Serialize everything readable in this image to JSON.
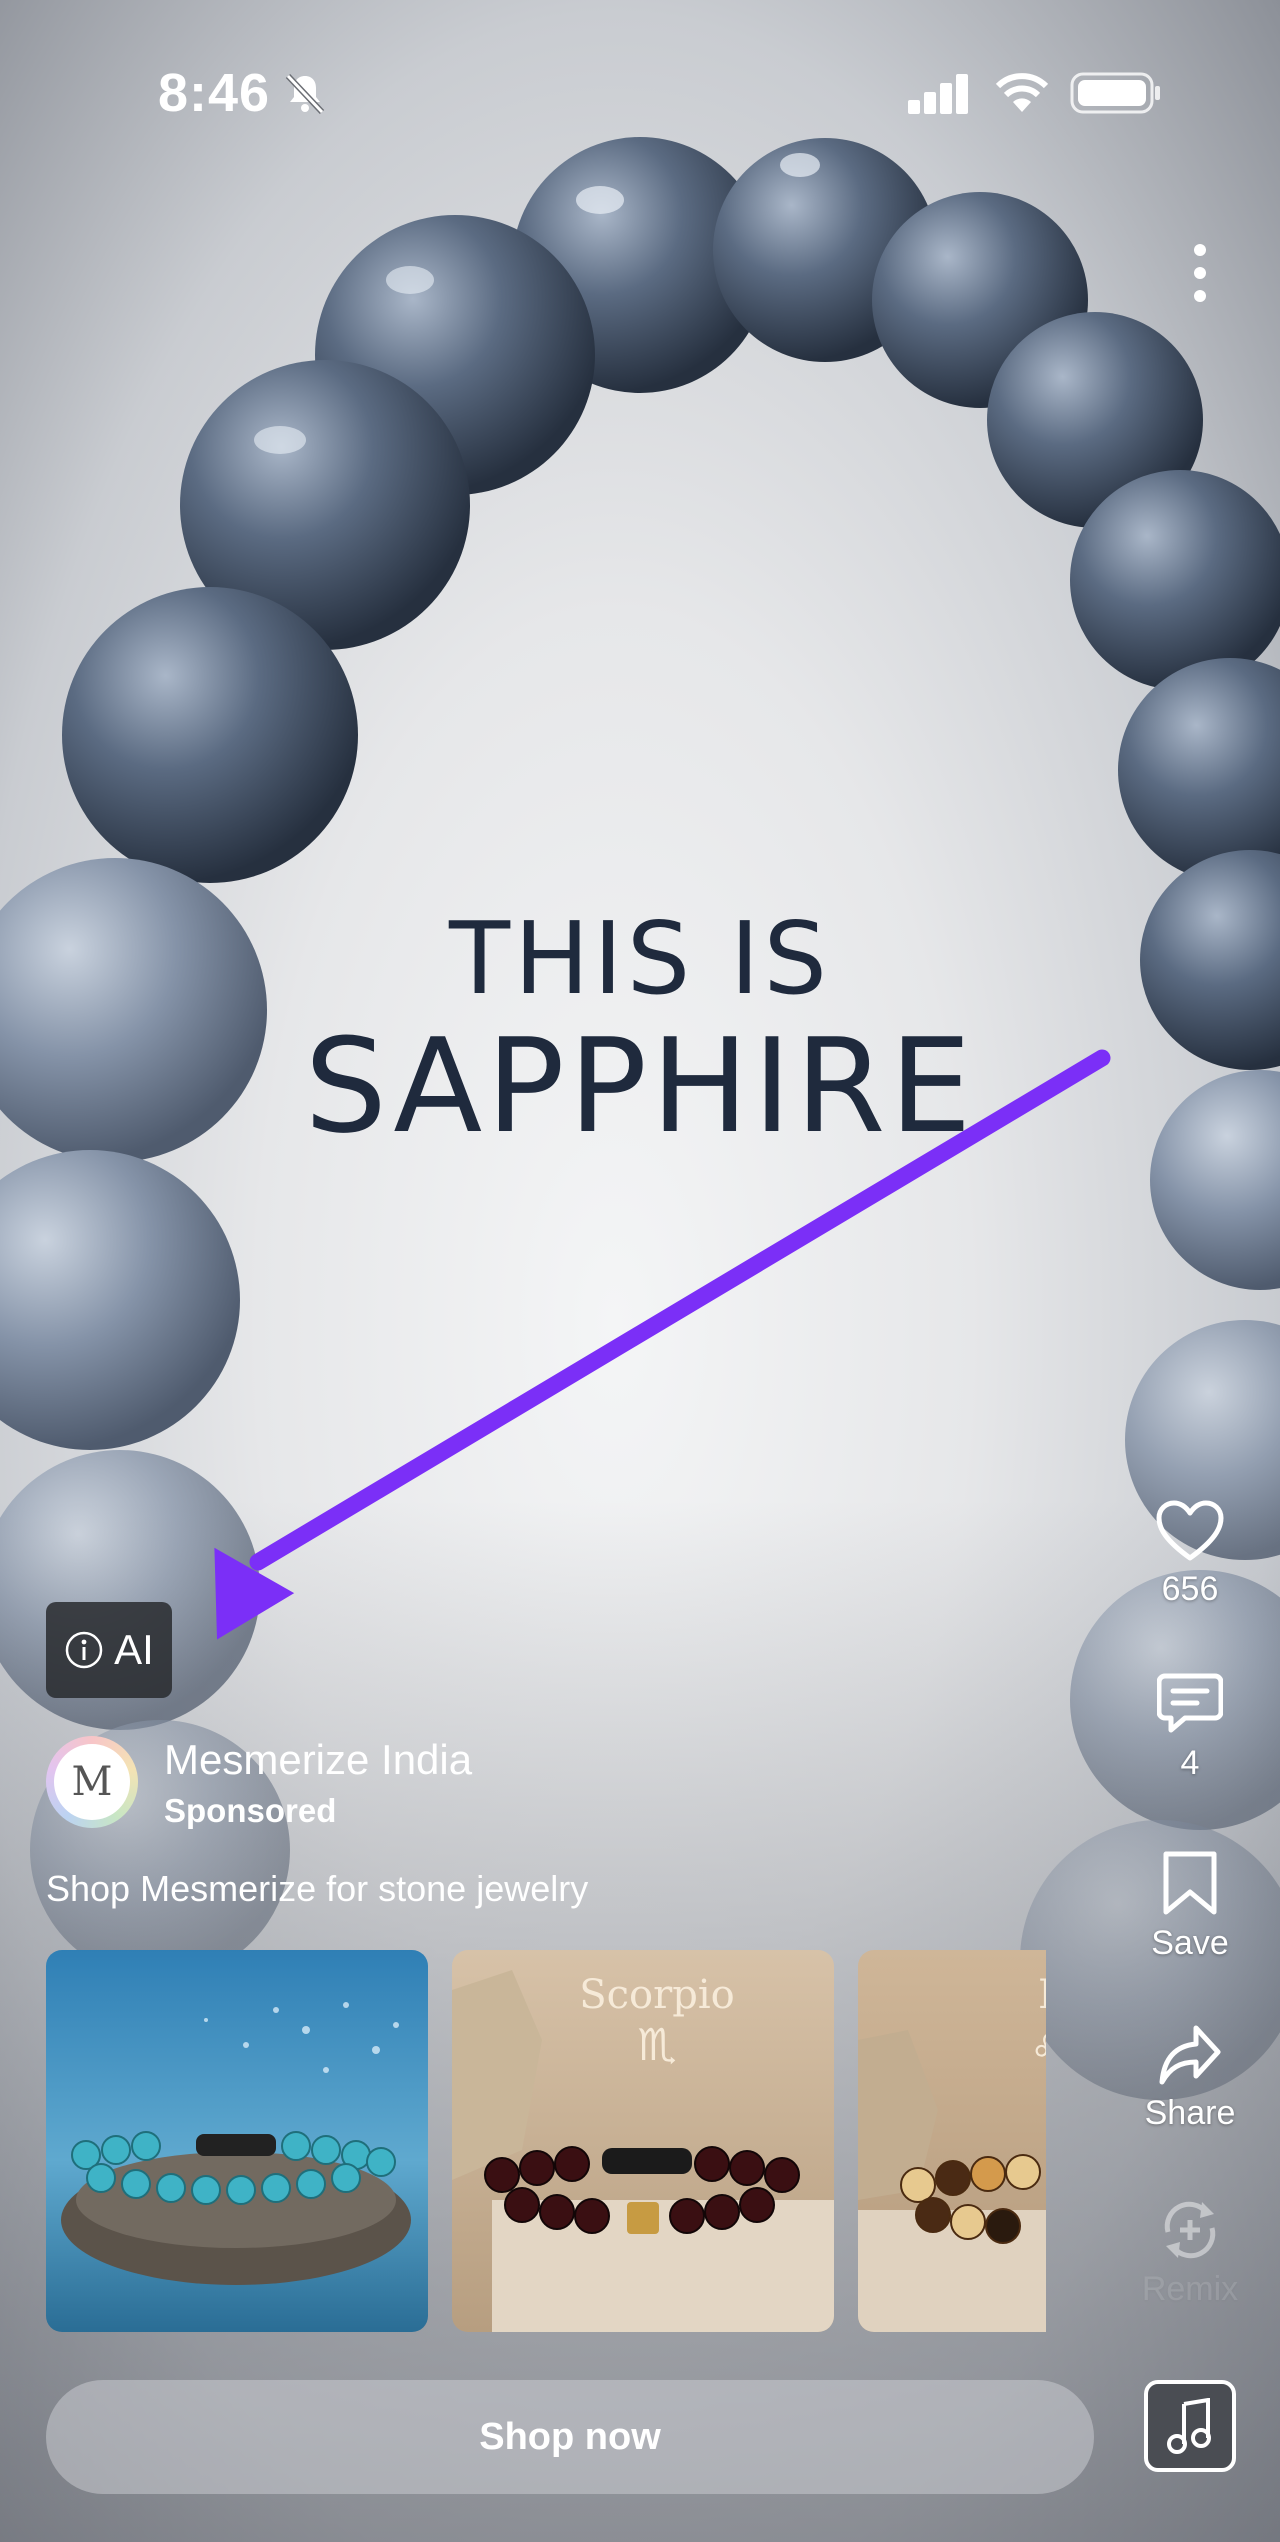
{
  "status_bar": {
    "time": "8:46",
    "icons": [
      "bell-slash-icon",
      "signal-icon",
      "wifi-icon",
      "battery-icon"
    ]
  },
  "media": {
    "headline_line1": "THIS IS",
    "headline_line2": "SAPPHIRE"
  },
  "ai_badge": {
    "label": "AI",
    "icon": "info-icon"
  },
  "rail": {
    "likes": "656",
    "comments": "4",
    "save_label": "Save",
    "share_label": "Share",
    "remix_label": "Remix"
  },
  "account": {
    "avatar_letter": "M",
    "name": "Mesmerize India",
    "sponsored": "Sponsored",
    "caption": "Shop Mesmerize for stone jewelry"
  },
  "products": [
    {
      "overlay": "",
      "theme": "turquoise bracelet on rock by sea"
    },
    {
      "overlay": "Scorpio",
      "symbol": "♏",
      "theme": "garnet bracelet on stone"
    },
    {
      "overlay": "L",
      "symbol": "♌",
      "theme": "amber bracelet on stone"
    }
  ],
  "cta": {
    "label": "Shop now"
  },
  "colors": {
    "arrow": "#7b2ff7",
    "headline": "#1f2a3d"
  }
}
